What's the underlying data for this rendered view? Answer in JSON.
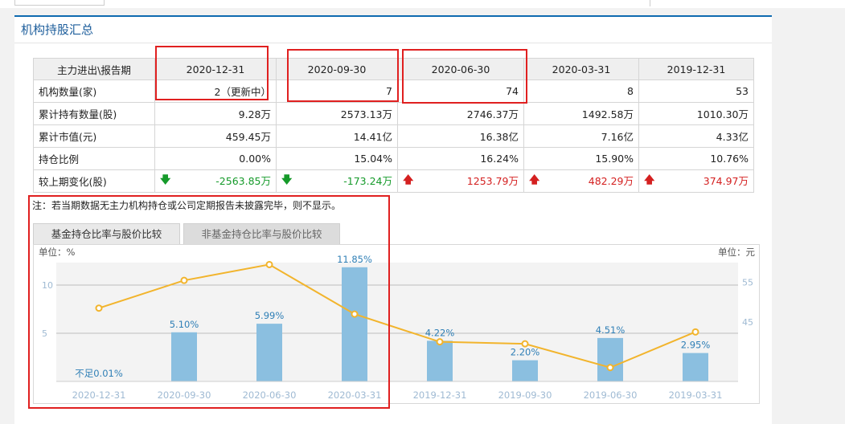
{
  "panel": {
    "title": "机构持股汇总"
  },
  "table": {
    "header_label": "主力进出\\报告期",
    "periods": [
      "2020-12-31",
      "2020-09-30",
      "2020-06-30",
      "2020-03-31",
      "2019-12-31"
    ],
    "rows": [
      {
        "label": "机构数量(家)",
        "values": [
          "2（更新中）",
          "7",
          "74",
          "8",
          "53"
        ]
      },
      {
        "label": "累计持有数量(股)",
        "values": [
          "9.28万",
          "2573.13万",
          "2746.37万",
          "1492.58万",
          "1010.30万"
        ]
      },
      {
        "label": "累计市值(元)",
        "values": [
          "459.45万",
          "14.41亿",
          "16.38亿",
          "7.16亿",
          "4.33亿"
        ]
      },
      {
        "label": "持仓比例",
        "values": [
          "0.00%",
          "15.04%",
          "16.24%",
          "15.90%",
          "10.76%"
        ]
      },
      {
        "label": "较上期变化(股)",
        "values": [
          "-2563.85万",
          "-173.24万",
          "1253.79万",
          "482.29万",
          "374.97万"
        ],
        "directions": [
          "down",
          "down",
          "up",
          "up",
          "up"
        ]
      }
    ]
  },
  "note": "注：若当期数据无主力机构持仓或公司定期报告未披露完毕，则不显示。",
  "tabs": {
    "fund": "基金持仓比率与股价比较",
    "nonfund": "非基金持仓比率与股价比较"
  },
  "colors": {
    "bar": "#8bbfe0",
    "line": "#f2b42c",
    "accent": "#0e6ab0",
    "highlight": "#e02020"
  },
  "chart_data": {
    "type": "bar",
    "categories": [
      "2020-12-31",
      "2020-09-30",
      "2020-06-30",
      "2020-03-31",
      "2019-12-31",
      "2019-09-30",
      "2019-06-30",
      "2019-03-31"
    ],
    "series": [
      {
        "type": "bar",
        "axis": "left",
        "values": [
          0.01,
          5.1,
          5.99,
          11.85,
          4.22,
          2.2,
          4.51,
          2.95
        ],
        "labels": [
          "不足0.01%",
          "5.10%",
          "5.99%",
          "11.85%",
          "4.22%",
          "2.20%",
          "4.51%",
          "2.95%"
        ]
      },
      {
        "type": "line",
        "axis": "right",
        "values": [
          48.5,
          55.5,
          59.5,
          47.0,
          40.0,
          39.5,
          33.5,
          42.5
        ]
      }
    ],
    "left_axis": {
      "unit_label": "单位：%",
      "ticks": [
        "10",
        "5"
      ],
      "ylim": [
        0,
        12.5
      ]
    },
    "right_axis": {
      "unit_label": "单位：元",
      "ticks": [
        "55",
        "45"
      ],
      "ylim": [
        30.0,
        60.4
      ]
    },
    "grid": true
  }
}
